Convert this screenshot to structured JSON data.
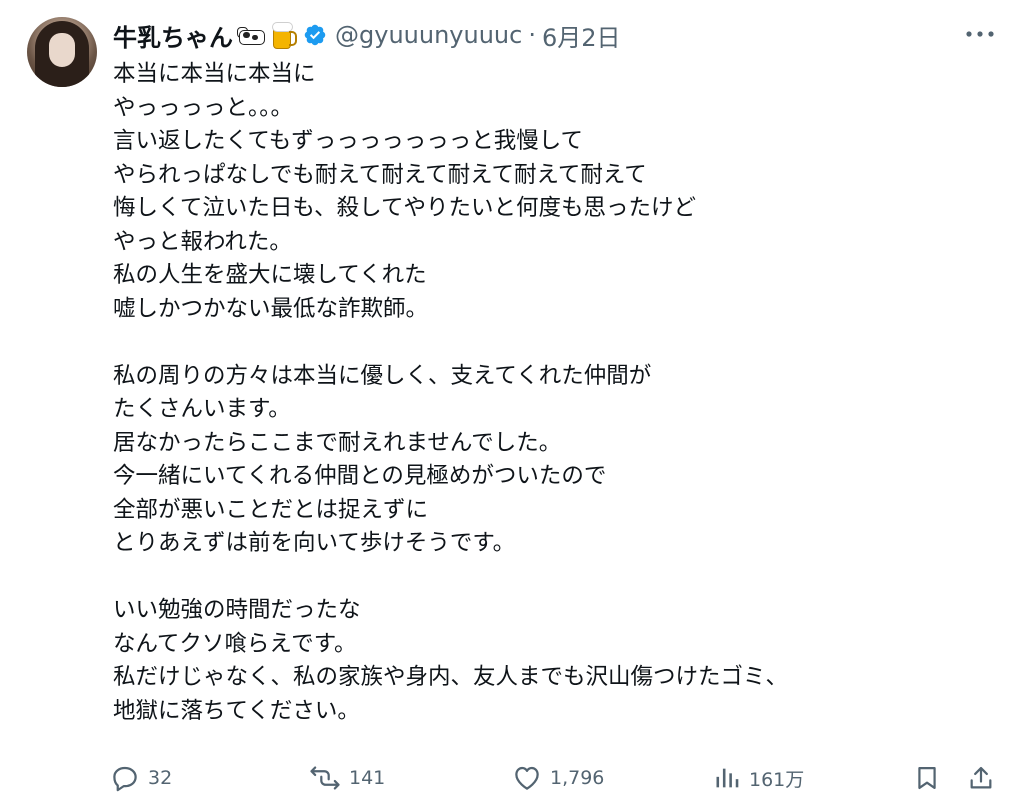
{
  "author": {
    "display_name": "牛乳ちゃん",
    "handle": "@gyuuunyuuuc",
    "separator": "·",
    "date": "6月2日",
    "emoji_icons": [
      "cow-icon",
      "beer-mug-icon"
    ],
    "verified": true
  },
  "tweet": {
    "paragraphs": [
      [
        "本当に本当に本当に",
        "やっっっっと。。。",
        "言い返したくてもずっっっっっっっと我慢して",
        "やられっぱなしでも耐えて耐えて耐えて耐えて耐えて",
        "悔しくて泣いた日も、殺してやりたいと何度も思ったけど",
        "やっと報われた。",
        "私の人生を盛大に壊してくれた",
        "嘘しかつかない最低な詐欺師。"
      ],
      [
        "私の周りの方々は本当に優しく、支えてくれた仲間が",
        "たくさんいます。",
        "居なかったらここまで耐えれませんでした。",
        "今一緒にいてくれる仲間との見極めがついたので",
        "全部が悪いことだとは捉えずに",
        "とりあえずは前を向いて歩けそうです。"
      ],
      [
        "いい勉強の時間だったな",
        "なんてクソ喰らえです。",
        "私だけじゃなく、私の家族や身内、友人までも沢山傷つけたゴミ、",
        "地獄に落ちてください。"
      ]
    ]
  },
  "actions": {
    "reply_count": "32",
    "retweet_count": "141",
    "like_count": "1,796",
    "view_count": "161万"
  },
  "colors": {
    "text": "#0f1419",
    "secondary": "#536471",
    "verified": "#1d9bf0"
  }
}
